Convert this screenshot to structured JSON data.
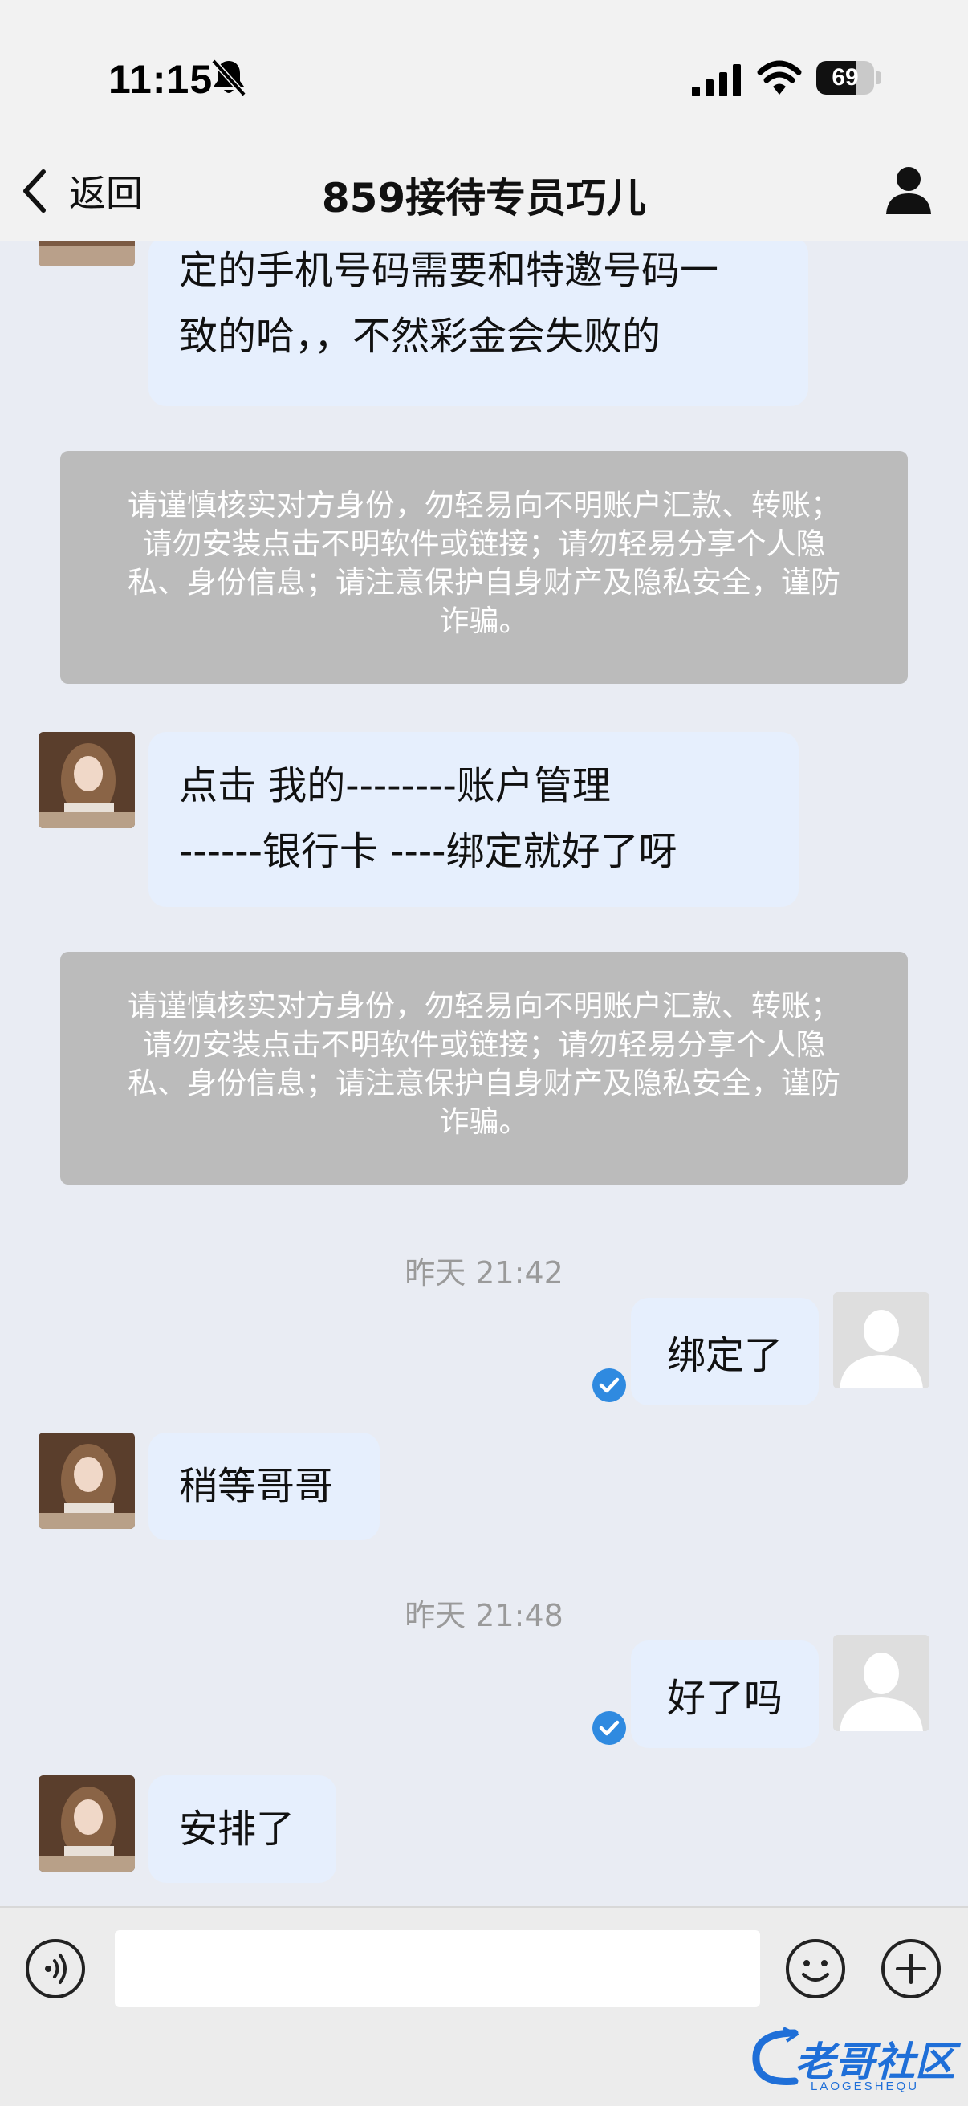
{
  "status_bar": {
    "time": "11:15",
    "battery": "69",
    "battery_percent": 69
  },
  "header": {
    "back_label": "返回",
    "title": "859接待专员巧儿"
  },
  "messages": {
    "m1_line1": "定的手机号码需要和特邀号码一",
    "m1_line2": "致的哈，，不然彩金会失败的",
    "notice1_line1": "请谨慎核实对方身份，勿轻易向不明账户汇款、转账；",
    "notice1_line2": "请勿安装点击不明软件或链接；请勿轻易分享个人隐",
    "notice1_line3": "私、身份信息；请注意保护自身财产及隐私安全，谨防",
    "notice1_line4": "诈骗。",
    "m2_line1": "点击 我的--------账户管理",
    "m2_line2": "------银行卡 ----绑定就好了呀",
    "notice2_line1": "请谨慎核实对方身份，勿轻易向不明账户汇款、转账；",
    "notice2_line2": "请勿安装点击不明软件或链接；请勿轻易分享个人隐",
    "notice2_line3": "私、身份信息；请注意保护自身财产及隐私安全，谨防",
    "notice2_line4": "诈骗。",
    "ts1": "昨天 21:42",
    "out1": "绑定了",
    "m3": "稍等哥哥",
    "ts2": "昨天 21:48",
    "out2": "好了吗",
    "m4": "安排了"
  },
  "watermark": {
    "text": "老哥社区",
    "sub": "LAOGESHEQU"
  },
  "colors": {
    "bubble": "#e6effd",
    "notice": "#bbbbbb",
    "check": "#2f8ae0",
    "background": "#e9ecf3"
  },
  "icons": [
    "bell-slash-icon",
    "signal-icon",
    "wifi-icon",
    "chevron-left-icon",
    "person-icon",
    "voice-icon",
    "emoji-icon",
    "plus-icon",
    "check-icon"
  ]
}
